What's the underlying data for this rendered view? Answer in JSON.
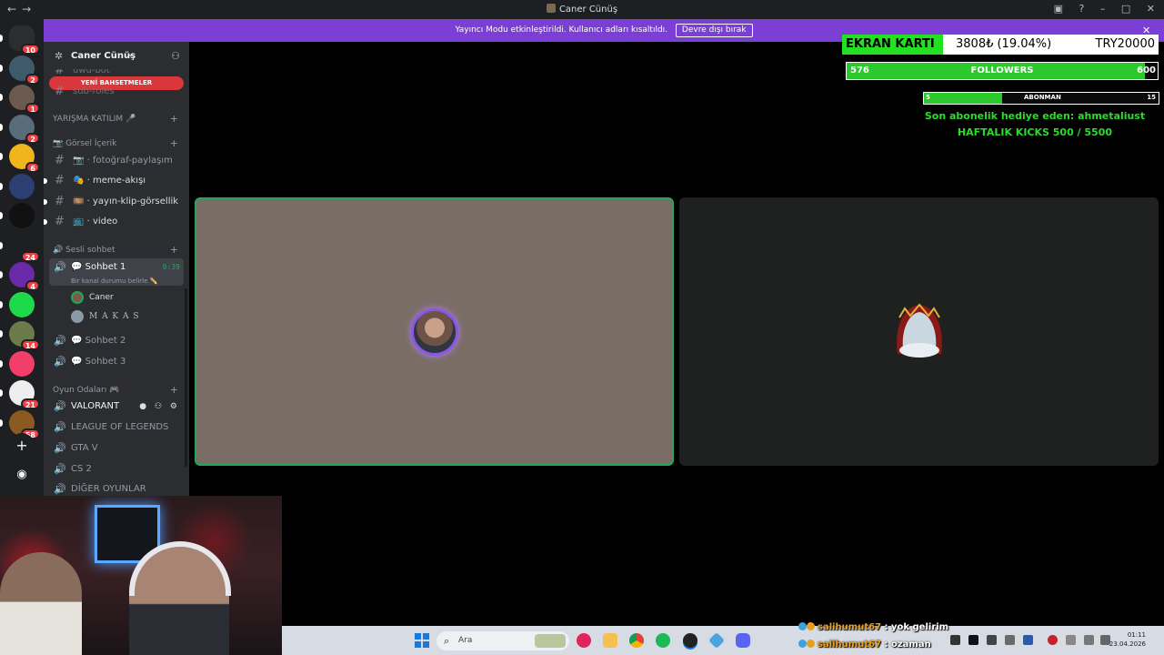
{
  "window": {
    "title": "Caner Cünüş",
    "nav_back": "←",
    "nav_forward": "→"
  },
  "banner": {
    "text": "Yayıncı Modu etkinleştirildi. Kullanıcı adları kısaltıldı.",
    "disable_button": "Devre dışı bırak"
  },
  "servers": [
    {
      "badge": "10",
      "color": "#2b2d31"
    },
    {
      "badge": "2",
      "color": "#3e5a6b"
    },
    {
      "badge": "1",
      "color": "#6b5a50"
    },
    {
      "badge": "2",
      "color": "#5a6b7a"
    },
    {
      "badge": "6",
      "color": "#f0b41c"
    },
    {
      "badge": "",
      "color": "#2c3e72"
    },
    {
      "badge": "",
      "color": "#111111"
    },
    {
      "badge": "24",
      "color": "#1e1f22"
    },
    {
      "badge": "4",
      "color": "#6a2aa8"
    },
    {
      "badge": "",
      "color": "#1ed94a"
    },
    {
      "badge": "14",
      "color": "#6b7a4a"
    },
    {
      "badge": "",
      "color": "#f23f6a"
    },
    {
      "badge": "21",
      "color": "#eeeeee"
    },
    {
      "badge": "58",
      "color": "#8a5a20"
    }
  ],
  "sidebar": {
    "server_name": "Caner Cünüş",
    "promo": "YENİ BAHSETMELER",
    "partial_channels": [
      "uwu-bot",
      "sub-roles"
    ],
    "categories": {
      "yarisma": "YARIŞMA KATILIM 🎤",
      "gorsel": "📷 Görsel İçerik",
      "sesli": "🔊 Sesli sohbet",
      "oyun": "Oyun Odaları 🎮"
    },
    "text_channels": [
      "📷 · fotoğraf-paylaşım",
      "🎭 · meme-akışı",
      "🎞️ · yayın-klip-görsellik",
      "📺 · video"
    ],
    "voice_active": {
      "name": "💬 Sohbet 1",
      "time": "0:39",
      "status": "Bir kanal durumu belirle ✏️",
      "users": [
        "Caner",
        "M A K A S"
      ]
    },
    "voice_channels": [
      "💬 Sohbet 2",
      "💬 Sohbet 3"
    ],
    "game_channels": [
      "VALORANT",
      "LEAGUE OF LEGENDS",
      "GTA V",
      "CS 2",
      "DİĞER OYUNLAR"
    ]
  },
  "overlay": {
    "gpu_label": "EKRAN KARTI",
    "gpu_amount": "3808₺ (19.04%)",
    "gpu_goal": "TRY20000",
    "gpu_progress": 0.1904,
    "followers_current": "576",
    "followers_label": "FOLLOWERS",
    "followers_goal": "600",
    "followers_progress": 0.96,
    "sub_current": "5",
    "sub_label": "ABONMAN",
    "sub_goal": "15",
    "sub_progress": 0.333,
    "gift_text": "Son abonelik hediye eden: ahmetaliust",
    "kicks_text": "HAFTALIK KICKS 500 / 5500"
  },
  "chat": [
    {
      "user": "salihumut67",
      "message": ": yok gelirim"
    },
    {
      "user": "salihumut67",
      "message": ": ozaman"
    }
  ],
  "taskbar": {
    "search_placeholder": "Ara",
    "time": "01:11",
    "date": "23.04.2026"
  },
  "colors": {
    "accent_green": "#23a55a",
    "banner_purple": "#7b3fd6",
    "promo_red": "#da373c"
  }
}
